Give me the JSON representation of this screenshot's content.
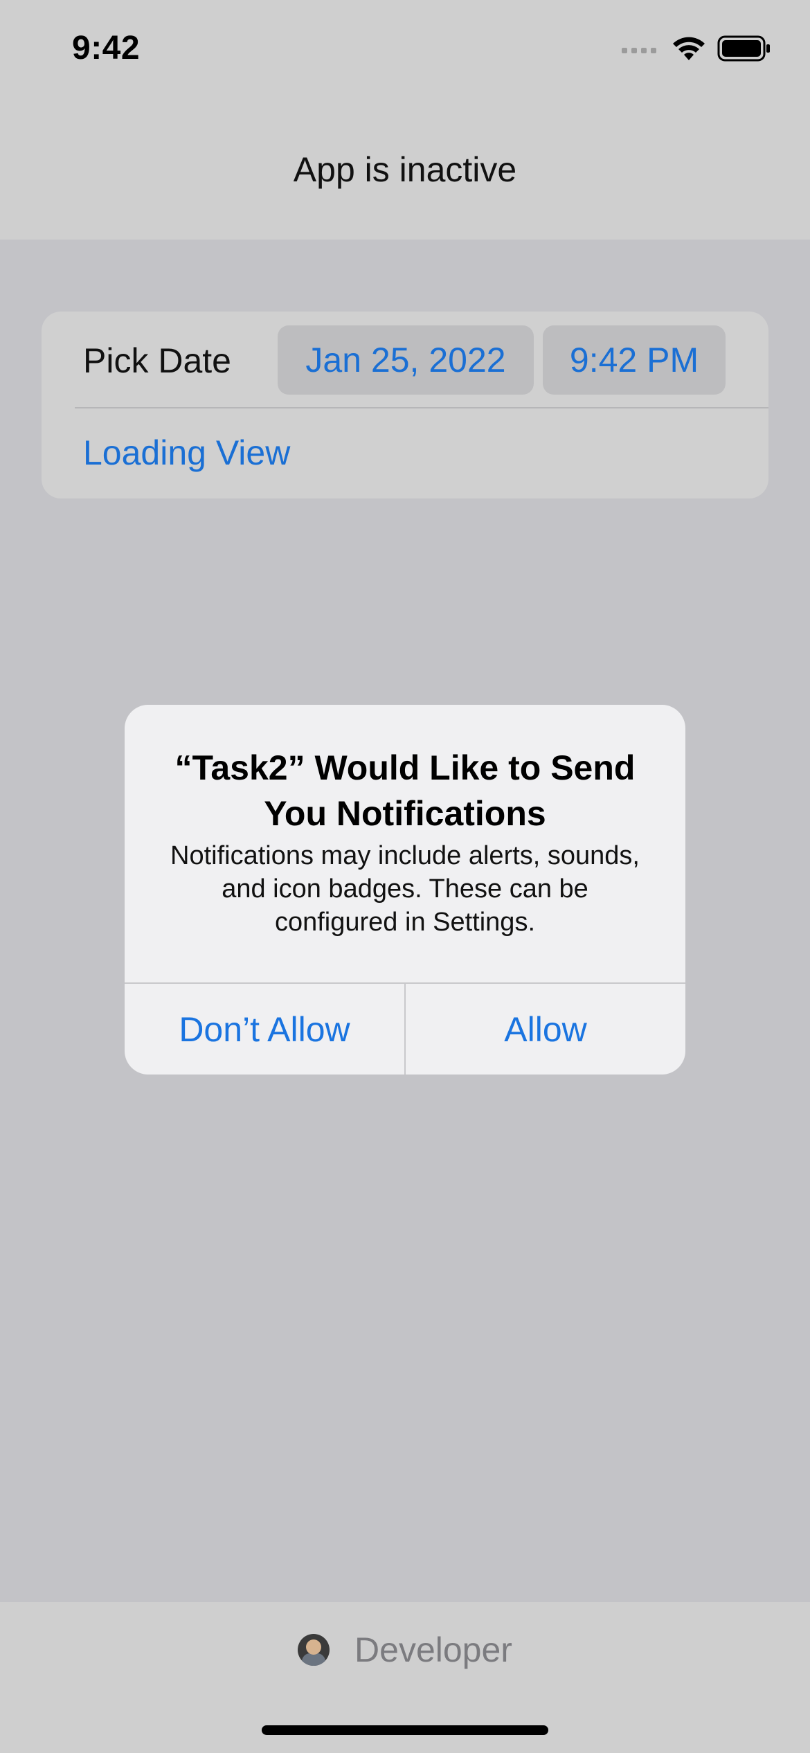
{
  "status_bar": {
    "time": "9:42",
    "icons": [
      "cellular-signal-icon",
      "wifi-icon",
      "battery-icon"
    ]
  },
  "nav": {
    "title": "App is inactive"
  },
  "form": {
    "date_row": {
      "label": "Pick Date",
      "date_value": "Jan 25, 2022",
      "time_value": "9:42 PM"
    },
    "loading_row": {
      "label": "Loading View"
    }
  },
  "alert": {
    "title": "“Task2” Would Like to Send You Notifications",
    "message": "Notifications may include alerts, sounds, and icon badges. These can be configured in Settings.",
    "deny_label": "Don’t Allow",
    "allow_label": "Allow"
  },
  "bottom": {
    "developer_label": "Developer"
  },
  "colors": {
    "accent": "#1a74e0",
    "dim_background": "#c3c3c7",
    "alert_background": "#f0f0f2"
  }
}
